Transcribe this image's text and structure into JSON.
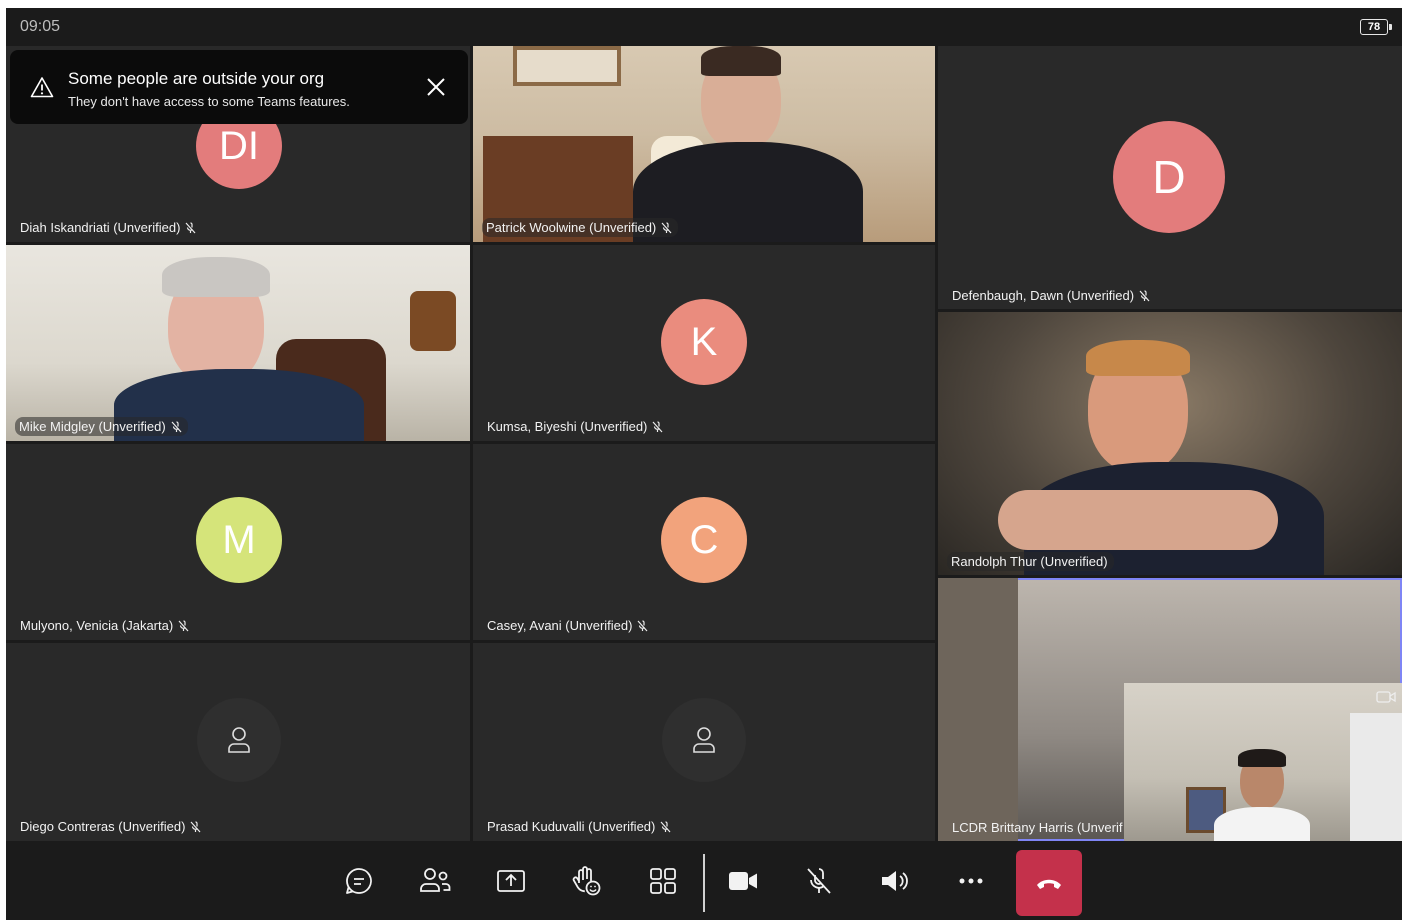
{
  "status": {
    "time": "09:05",
    "battery": "78"
  },
  "banner": {
    "title": "Some people are outside your org",
    "subtitle": "They don't have access to some Teams features."
  },
  "participants": [
    {
      "name": "Diah Iskandriati (Unverified)",
      "initials": "DI",
      "avatar_color": "#e37c7c",
      "muted": true
    },
    {
      "name": "Patrick Woolwine (Unverified)",
      "video": true,
      "muted": true
    },
    {
      "name": "Defenbaugh, Dawn (Unverified)",
      "initials": "D",
      "avatar_color": "#e37c7c",
      "muted": true
    },
    {
      "name": "Mike Midgley (Unverified)",
      "video": true,
      "muted": true
    },
    {
      "name": "Kumsa, Biyeshi (Unverified)",
      "initials": "K",
      "avatar_color": "#ea8c7e",
      "muted": true
    },
    {
      "name": "Randolph Thur (Unverified)",
      "video": true,
      "muted": false
    },
    {
      "name": "Mulyono, Venicia (Jakarta)",
      "initials": "M",
      "avatar_color": "#d5e47a",
      "muted": true
    },
    {
      "name": "Casey, Avani (Unverified)",
      "initials": "C",
      "avatar_color": "#f2a37c",
      "muted": true
    },
    {
      "name": "LCDR Brittany Harris (Unverified)",
      "label_visible": "LCDR Brittany Harris (Unverif",
      "video": true,
      "selected": true
    },
    {
      "name": "Diego Contreras (Unverified)",
      "icon": "person-icon",
      "muted": true
    },
    {
      "name": "Prasad Kuduvalli (Unverified)",
      "icon": "person-icon",
      "muted": true
    }
  ],
  "toolbar": {
    "buttons": [
      "chat-icon",
      "people-icon",
      "share-screen-icon",
      "raise-hand-icon",
      "layout-icon",
      "camera-icon",
      "mic-muted-icon",
      "speaker-icon",
      "more-icon",
      "hang-up-icon"
    ],
    "hangup_color": "#c4314b"
  },
  "accent": "#7f85f5"
}
